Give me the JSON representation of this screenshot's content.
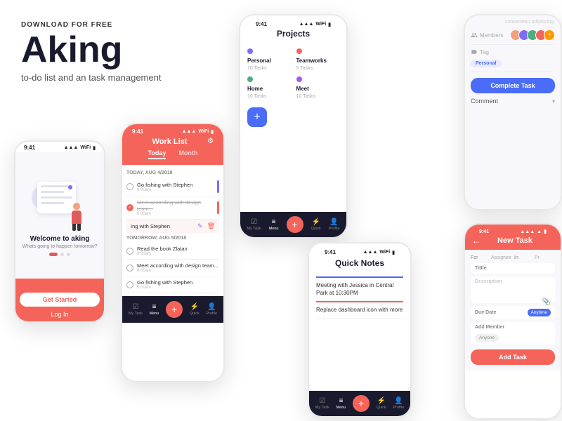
{
  "hero": {
    "download_label": "DOWNLOAD FOR FREE",
    "app_name": "Aking",
    "tagline": "to-do list and an task management"
  },
  "phone1": {
    "status_time": "9:41",
    "welcome_title": "Welcome to aking",
    "welcome_sub": "Whats going to happen tomorrow?",
    "btn_started": "Get Started",
    "btn_login": "Log In"
  },
  "phone2": {
    "status_time": "9:41",
    "header_title": "Work List",
    "tab_today": "Today",
    "tab_month": "Month",
    "section1_label": "TODAY, AUG 4/2018",
    "task1_text": "Go fishing with Stephen",
    "task1_time": "9:00am",
    "task2_text": "Meet according with design team...",
    "task2_time": "9:00am",
    "swipe_text": "Ing with Stephen",
    "section2_label": "TOMORROW, AUG 5/2018",
    "task3_text": "Read the book Zlatan",
    "task3_time": "9:00am",
    "task4_text": "Meet according with design team...",
    "task4_time": "9:00am",
    "task5_text": "Go fishing with Stephen",
    "task5_time": "9:00am",
    "nav_items": [
      "My Task",
      "Menu",
      "+",
      "Quick",
      "Profile"
    ]
  },
  "phone3": {
    "status_time": "9:41",
    "header_title": "Projects",
    "projects": [
      {
        "name": "Personal",
        "tasks": "10 Tasks",
        "color": "#7c6ef7"
      },
      {
        "name": "Teamworks",
        "tasks": "5 Tasks",
        "color": "#f5645a"
      },
      {
        "name": "Home",
        "tasks": "10 Tasks",
        "color": "#4caf7d"
      },
      {
        "name": "Meet",
        "tasks": "10 Tasks",
        "color": "#a855f7"
      }
    ],
    "add_label": "+",
    "nav_items": [
      "My Task",
      "Menu",
      "+",
      "Quick",
      "Profile"
    ]
  },
  "phone4": {
    "members_label": "Members",
    "tag_label": "Tag",
    "tag_value": "Personal",
    "btn_complete": "Complete Task",
    "comment_label": "Comment"
  },
  "phone5": {
    "status_time": "9:41",
    "title": "Quick Notes",
    "note1": "Meeting with Jessica in Central Park at 10:30PM",
    "note2": "Replace dashboard icon with more",
    "nav_items": [
      "My Task",
      "Menu",
      "+",
      "Quick",
      "Profile"
    ]
  },
  "phone6": {
    "status_time": "9:41",
    "title": "New Task",
    "for_label": "For",
    "assignee_label": "Assignee",
    "in_label": "In",
    "pr_label": "Pr",
    "title_field_label": "Tittle",
    "desc_placeholder": "Description",
    "due_date_label": "Due Date",
    "due_date_value": "Anytime",
    "member_label": "Add Member",
    "member_value": "Anyone",
    "btn_add": "Add Task"
  }
}
